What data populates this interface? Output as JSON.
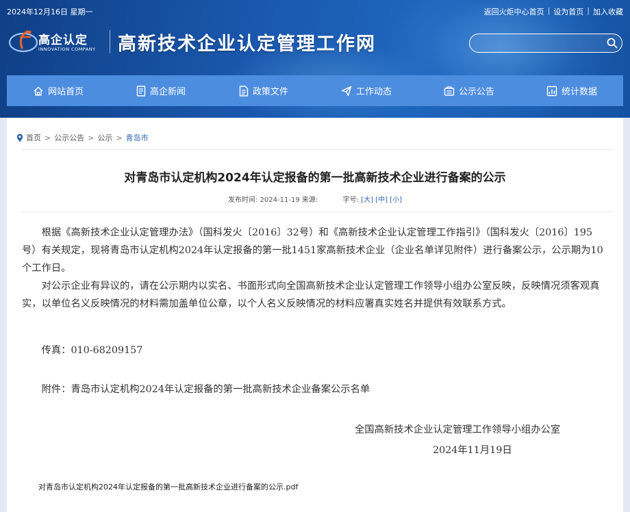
{
  "topbar": {
    "date": "2024年12月16日 星期一",
    "links": [
      "返回火炬中心首页",
      "设为首页",
      "加入收藏"
    ],
    "separator": "|"
  },
  "logo": {
    "brand": "高企认定",
    "subtitle": "INNOVATION COMPANY"
  },
  "site_title": "高新技术企业认定管理工作网",
  "search": {
    "placeholder": "",
    "icon": "search-icon"
  },
  "nav": [
    {
      "label": "网站首页",
      "icon": "home-icon"
    },
    {
      "label": "高企新闻",
      "icon": "document-icon"
    },
    {
      "label": "政策文件",
      "icon": "file-list-icon"
    },
    {
      "label": "工作动态",
      "icon": "paper-plane-icon"
    },
    {
      "label": "公示公告",
      "icon": "notice-icon"
    },
    {
      "label": "统计数据",
      "icon": "chart-icon"
    }
  ],
  "breadcrumb": {
    "icon": "location-pin-icon",
    "items": [
      "首页",
      "公示公告",
      "公示"
    ],
    "current": "青岛市",
    "sep": ">"
  },
  "article": {
    "title": "对青岛市认定机构2024年认定报备的第一批高新技术企业进行备案的公示",
    "meta": {
      "published_label": "发布时间:",
      "published": "2024-11-19",
      "source_label": "来源:",
      "font_label": "字号:",
      "sizes": [
        "[大]",
        "[中]",
        "[小]"
      ]
    },
    "paragraphs": [
      "根据《高新技术企业认定管理办法》（国科发火〔2016〕32号）和《高新技术企业认定管理工作指引》（国科发火〔2016〕195号）有关规定，现将青岛市认定机构2024年认定报备的第一批1451家高新技术企业（企业名单详见附件）进行备案公示，公示期为10个工作日。",
      "对公示企业有异议的，请在公示期内以实名、书面形式向全国高新技术企业认定管理工作领导小组办公室反映，反映情况须客观真实，以单位名义反映情况的材料需加盖单位公章，以个人名义反映情况的材料应署真实姓名并提供有效联系方式。"
    ],
    "fax": "传真：010-68209157",
    "attachment": "附件：青岛市认定机构2024年认定报备的第一批高新技术企业备案公示名单",
    "signature_org": "全国高新技术企业认定管理工作领导小组办公室",
    "signature_date": "2024年11月19日",
    "pdf_link": "对青岛市认定机构2024年认定报备的第一批高新技术企业进行备案的公示.pdf"
  },
  "colors": {
    "header_blue": "#1a58ad",
    "nav_blue": "#4d8de0",
    "logo_orange": "#e8612a",
    "link_blue": "#2d63b0"
  }
}
